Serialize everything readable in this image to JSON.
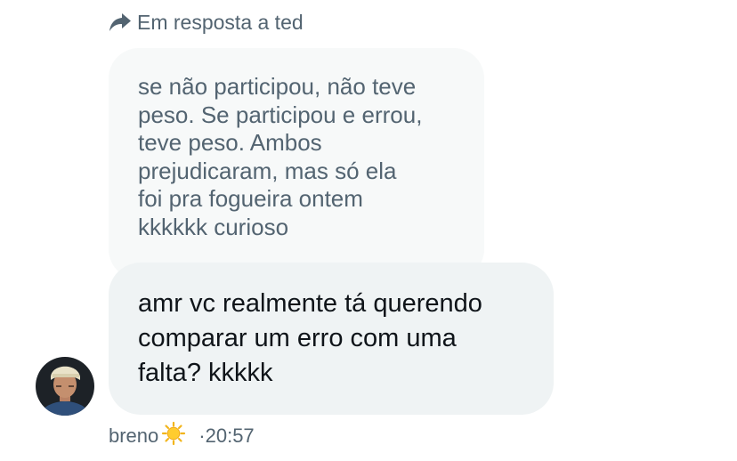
{
  "reply_context": {
    "icon": "reply-arrow-icon",
    "label": "Em resposta a ted"
  },
  "quoted_message": {
    "text": "se não participou, não teve\npeso. Se participou e errou,\nteve peso. Ambos\nprejudicaram, mas só ela\nfoi pra fogueira ontem\nkkkkkk curioso"
  },
  "message": {
    "text": "amr vc realmente tá querendo\ncomparar um erro com uma\nfalta? kkkkk"
  },
  "sender": {
    "name": "breno",
    "emoji": "sun-icon",
    "separator": "·",
    "time": "20:57"
  },
  "colors": {
    "secondary_text": "#536471",
    "primary_text": "#0f1419",
    "quoted_bubble_bg": "#f7f9f9",
    "message_bubble_bg": "#eff3f4"
  }
}
